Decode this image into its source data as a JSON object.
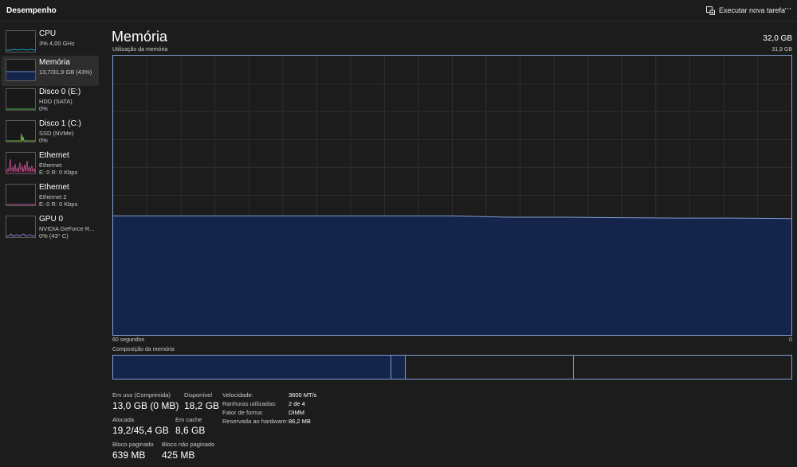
{
  "window": {
    "title": "Desempenho",
    "run_task_label": "Executar nova tarefa",
    "run_task_icon": "run-task-icon",
    "more_label": "···"
  },
  "sidebar": {
    "items": [
      {
        "name": "CPU",
        "sub1": "3% 4,00 GHz",
        "sub2": "",
        "color": "#17a0c8"
      },
      {
        "name": "Memória",
        "sub1": "13,7/31,9 GB (43%)",
        "sub2": "",
        "color": "#6a8fd4"
      },
      {
        "name": "Disco 0 (E:)",
        "sub1": "HDD (SATA)",
        "sub2": "0%",
        "color": "#4caf50"
      },
      {
        "name": "Disco 1 (C:)",
        "sub1": "SSD (NVMe)",
        "sub2": "0%",
        "color": "#6dbb3c"
      },
      {
        "name": "Ethernet",
        "sub1": "Ethernet",
        "sub2": "E: 0 R: 0 Kbps",
        "color": "#c0508a"
      },
      {
        "name": "Ethernet",
        "sub1": "Ethernet 2",
        "sub2": "E: 0 R: 0 Kbps",
        "color": "#c0508a"
      },
      {
        "name": "GPU 0",
        "sub1": "NVIDIA GeForce R...",
        "sub2": "0% (43° C)",
        "color": "#7d7fd0"
      }
    ]
  },
  "main": {
    "title": "Memória",
    "total": "32,0 GB",
    "usage_label": "Utilização da memória",
    "usage_max": "31,9 GB",
    "axis_left": "60 segundos",
    "axis_right": "0",
    "composition_label": "Composição da memória"
  },
  "chart_data": {
    "type": "area",
    "ylim": [
      0,
      31.9
    ],
    "xlim": [
      60,
      0
    ],
    "grid": true,
    "color": "#7f9ed2",
    "fill": "#14244a",
    "x": [
      60,
      55,
      50,
      45,
      40,
      35,
      30,
      25,
      20,
      15,
      10,
      5,
      0
    ],
    "values": [
      13.6,
      13.6,
      13.6,
      13.6,
      13.6,
      13.6,
      13.6,
      13.45,
      13.45,
      13.4,
      13.35,
      13.35,
      13.3
    ]
  },
  "stats": {
    "in_use_label": "Em uso (Comprimida)",
    "in_use_value": "13,0 GB (0 MB)",
    "available_label": "Disponível",
    "available_value": "18,2 GB",
    "committed_label": "Alocada",
    "committed_value": "19,2/45,4 GB",
    "cached_label": "Em cache",
    "cached_value": "8,6 GB",
    "paged_label": "Bloco paginado",
    "paged_value": "639 MB",
    "nonpaged_label": "Bloco não paginado",
    "nonpaged_value": "425 MB"
  },
  "properties": {
    "speed_label": "Velocidade:",
    "speed_value": "3600 MT/s",
    "slots_label": "Ranhuras utilizadas:",
    "slots_value": "2 de 4",
    "form_label": "Fator de forma:",
    "form_value": "DIMM",
    "reserved_label": "Reservada ao hardware:",
    "reserved_value": "86,2 MB"
  }
}
